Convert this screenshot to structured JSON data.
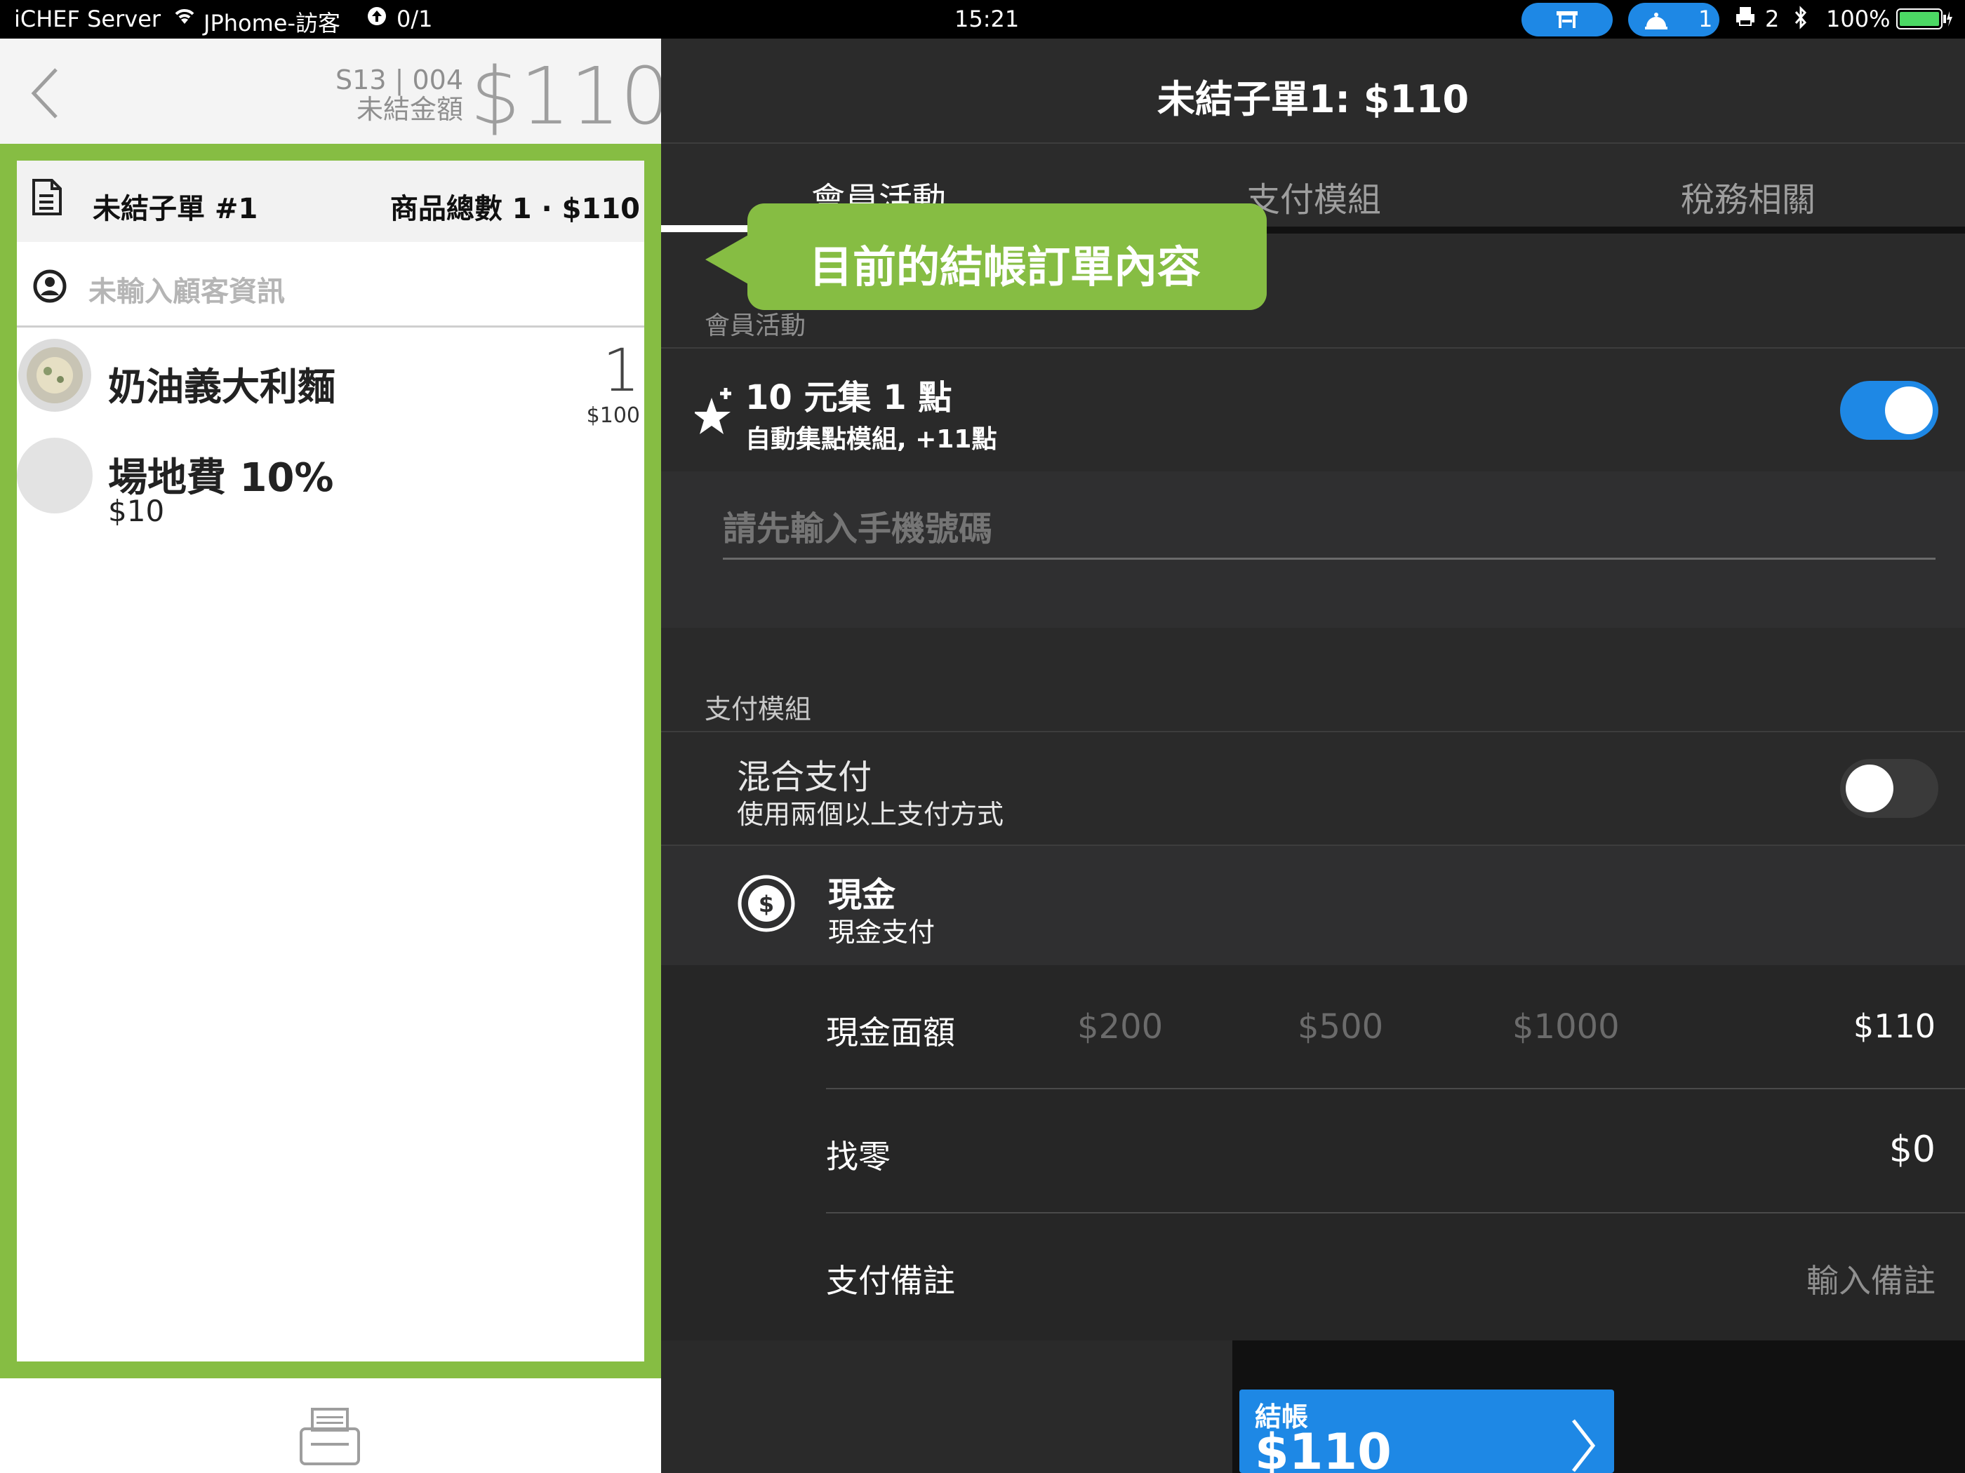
{
  "status_bar": {
    "carrier": "iCHEF Server",
    "wifi_name": "JPhome-訪客",
    "sync": "0/1",
    "time": "15:21",
    "bell_count": "1",
    "printer_count": "2",
    "battery": "100%"
  },
  "order_header": {
    "order_code_line1": "S13 | 004",
    "order_code_line2": "未結金額",
    "amount": "$110"
  },
  "suborder": {
    "title": "未結子單 #1",
    "summary": "商品總數 1 · $110",
    "customer_placeholder": "未輸入顧客資訊"
  },
  "items": [
    {
      "name": "奶油義大利麵",
      "qty": "1",
      "price": "$100"
    },
    {
      "name": "場地費 10%",
      "price": "$10"
    }
  ],
  "right_header": {
    "title": "未結子單1: $110"
  },
  "tabs": [
    "會員活動",
    "支付模組",
    "稅務相關"
  ],
  "callout": {
    "text": "目前的結帳訂單內容"
  },
  "member_section": {
    "label": "會員活動",
    "promo_title": "10 元集 1 點",
    "promo_subtitle": "自動集點模組, +11點",
    "promo_enabled": true,
    "phone_placeholder": "請先輸入手機號碼"
  },
  "payment_section": {
    "label": "支付模組",
    "mixed_title": "混合支付",
    "mixed_subtitle": "使用兩個以上支付方式",
    "mixed_enabled": false,
    "cash_title": "現金",
    "cash_subtitle": "現金支付",
    "cash_amount_label": "現金面額",
    "quick_amounts": [
      "$200",
      "$500",
      "$1000"
    ],
    "cash_amount_value": "$110",
    "change_label": "找零",
    "change_value": "$0",
    "note_label": "支付備註",
    "note_placeholder": "輸入備註"
  },
  "checkout": {
    "label": "結帳",
    "amount": "$110"
  },
  "colors": {
    "accent_blue": "#1e88e5",
    "highlight_green": "#86bd43"
  },
  "icons": [
    "wifi-icon",
    "upload-icon",
    "table-icon",
    "bell-icon",
    "printer-icon",
    "bluetooth-icon",
    "battery-icon",
    "back-chevron-icon",
    "document-icon",
    "user-icon",
    "star-plus-icon",
    "cash-icon",
    "print-icon",
    "forward-chevron-icon"
  ]
}
